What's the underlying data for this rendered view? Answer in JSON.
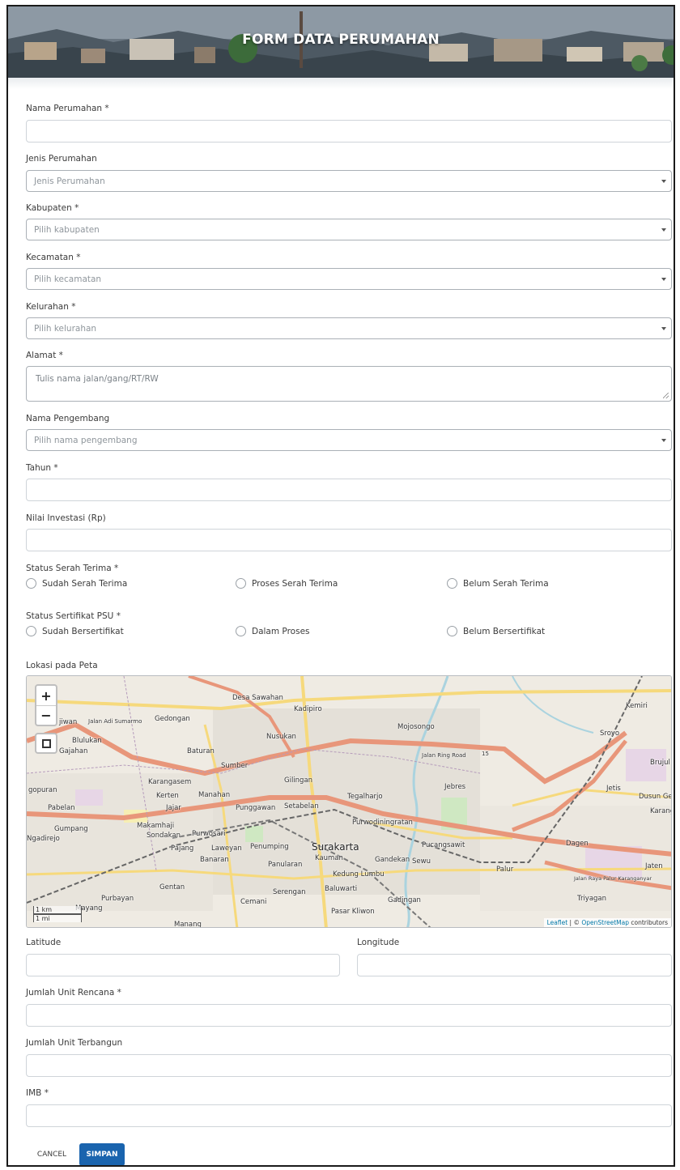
{
  "header": {
    "title": "FORM DATA PERUMAHAN"
  },
  "form": {
    "nama_perumahan": {
      "label": "Nama Perumahan *",
      "value": ""
    },
    "jenis_perumahan": {
      "label": "Jenis Perumahan",
      "placeholder": "Jenis Perumahan"
    },
    "kabupaten": {
      "label": "Kabupaten *",
      "placeholder": "Pilih kabupaten"
    },
    "kecamatan": {
      "label": "Kecamatan *",
      "placeholder": "Pilih kecamatan"
    },
    "kelurahan": {
      "label": "Kelurahan *",
      "placeholder": "Pilih kelurahan"
    },
    "alamat": {
      "label": "Alamat *",
      "placeholder": "Tulis nama jalan/gang/RT/RW"
    },
    "nama_pengembang": {
      "label": "Nama Pengembang",
      "placeholder": "Pilih nama pengembang"
    },
    "tahun": {
      "label": "Tahun *",
      "value": ""
    },
    "nilai_investasi": {
      "label": "Nilai Investasi (Rp)",
      "value": ""
    },
    "status_serah_terima": {
      "label": "Status Serah Terima *",
      "options": [
        "Sudah Serah Terima",
        "Proses Serah Terima",
        "Belum Serah Terima"
      ]
    },
    "status_sertifikat": {
      "label": "Status Sertifikat PSU *",
      "options": [
        "Sudah Bersertifikat",
        "Dalam Proses",
        "Belum Bersertifikat"
      ]
    },
    "lokasi": {
      "label": "Lokasi pada Peta"
    },
    "latitude": {
      "label": "Latitude",
      "value": ""
    },
    "longitude": {
      "label": "Longitude",
      "value": ""
    },
    "jumlah_unit_rencana": {
      "label": "Jumlah Unit Rencana *",
      "value": ""
    },
    "jumlah_unit_terbangun": {
      "label": "Jumlah Unit Terbangun",
      "value": ""
    },
    "imb": {
      "label": "IMB *",
      "value": ""
    }
  },
  "map": {
    "zoom_in": "+",
    "zoom_out": "−",
    "scale_km": "1 km",
    "scale_mi": "1 mi",
    "attribution_leaflet": "Leaflet",
    "attribution_sep": " | © ",
    "attribution_osm": "OpenStreetMap",
    "attribution_suffix": " contributors",
    "places": {
      "desa_sawahan": "Desa Sawahan",
      "kadipiro": "Kadipiro",
      "gedongan": "Gedongan",
      "jiwan": "jiwan",
      "jalan_adi_sumarmo": "Jalan Adi Sumarmo",
      "blulukan": "Blulukan",
      "gajahan": "Gajahan",
      "baturan": "Baturan",
      "nusukan": "Nusukan",
      "sumber": "Sumber",
      "mojosongo": "Mojosongo",
      "jalan_ring_road": "Jalan Ring Road",
      "ring_road_num": "15",
      "sroyo": "Sroyo",
      "kemiri": "Kemiri",
      "brujul": "Brujul",
      "gilingan": "Gilingan",
      "karangasem": "Karangasem",
      "kerten": "Kerten",
      "manahan": "Manahan",
      "jebres": "Jebres",
      "jetis": "Jetis",
      "dusun_gen": "Dusun Gen",
      "karangr": "Karangr",
      "gopuran": "gopuran",
      "pabelan": "Pabelan",
      "jajar": "Jajar",
      "punggawan": "Punggawan",
      "setabelan": "Setabelan",
      "tegalharjo": "Tegalharjo",
      "purwodiningratan": "Purwodiningratan",
      "gumpang": "Gumpang",
      "makamhaji": "Makamhaji",
      "sondakan": "Sondakan",
      "purwosari": "Purwosari",
      "ngadirejo": "Ngadirejo",
      "pajang": "Pajang",
      "laweyan": "Laweyan",
      "penumping": "Penumping",
      "surakarta": "Surakarta",
      "pucangsawit": "Pucangsawit",
      "dagen": "Dagen",
      "kauman": "Kauman",
      "gandekan": "Gandekan",
      "sewu": "Sewu",
      "banaran": "Banaran",
      "panularan": "Panularan",
      "palur": "Palur",
      "jaten": "Jaten",
      "kedung_lumbu": "Kedung Lumbu",
      "gentan": "Gentan",
      "serengan": "Serengan",
      "baluwarti": "Baluwarti",
      "triyagan": "Triyagan",
      "purbayan": "Purbayan",
      "mayang": "Mayang",
      "cemani": "Cemani",
      "gadingan": "Gadingan",
      "pasar_kliwon": "Pasar Kliwon",
      "manang": "Manang",
      "jalan_bypass": "Jalan Raya Palur Karanganyar"
    }
  },
  "actions": {
    "cancel": "CANCEL",
    "save": "SIMPAN"
  },
  "colors": {
    "primary": "#1a64ae",
    "road_major": "#e8967a",
    "road_secondary": "#f6d97c"
  }
}
